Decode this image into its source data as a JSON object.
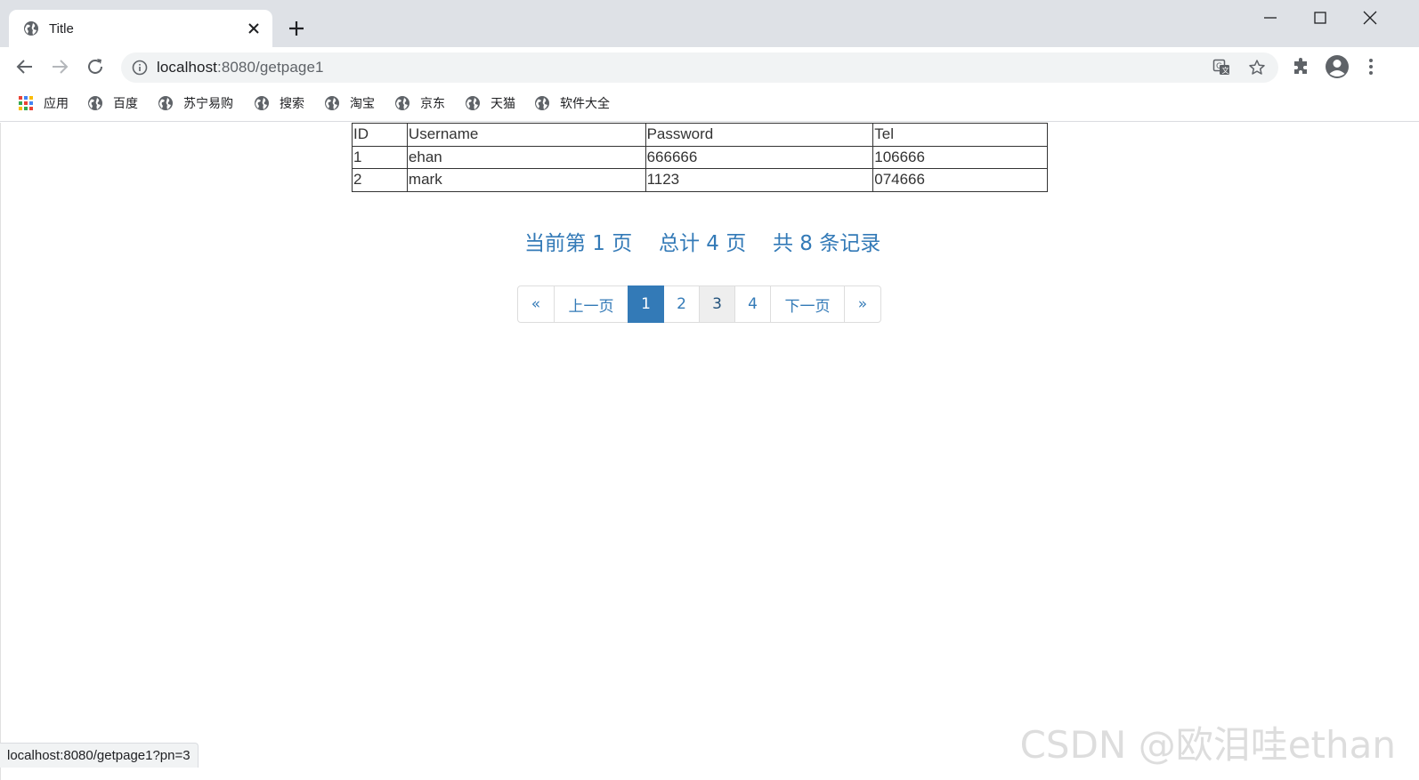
{
  "browser": {
    "tab_title": "Title",
    "url_host": "localhost",
    "url_rest": ":8080/getpage1",
    "bookmarks": [
      {
        "label": "应用",
        "icon": "apps-grid-icon"
      },
      {
        "label": "百度",
        "icon": "globe-icon"
      },
      {
        "label": "苏宁易购",
        "icon": "globe-icon"
      },
      {
        "label": "搜索",
        "icon": "globe-icon"
      },
      {
        "label": "淘宝",
        "icon": "globe-icon"
      },
      {
        "label": "京东",
        "icon": "globe-icon"
      },
      {
        "label": "天猫",
        "icon": "globe-icon"
      },
      {
        "label": "软件大全",
        "icon": "globe-icon"
      }
    ]
  },
  "table": {
    "headers": [
      "ID",
      "Username",
      "Password",
      "Tel"
    ],
    "rows": [
      [
        "1",
        "ehan",
        "666666",
        "106666"
      ],
      [
        "2",
        "mark",
        "1123",
        "074666"
      ]
    ]
  },
  "page_info": {
    "current": "当前第 1 页",
    "total_pages": "总计 4 页",
    "total_records": "共 8 条记录"
  },
  "pagination": {
    "first": "«",
    "prev": "上一页",
    "pages": [
      "1",
      "2",
      "3",
      "4"
    ],
    "active_page": "1",
    "next": "下一页",
    "last": "»"
  },
  "status_url": "localhost:8080/getpage1?pn=3",
  "watermark": "CSDN @欧泪哇ethan",
  "colors": {
    "link": "#337ab7",
    "active_bg": "#337ab7",
    "chrome_frame": "#dee1e6"
  }
}
